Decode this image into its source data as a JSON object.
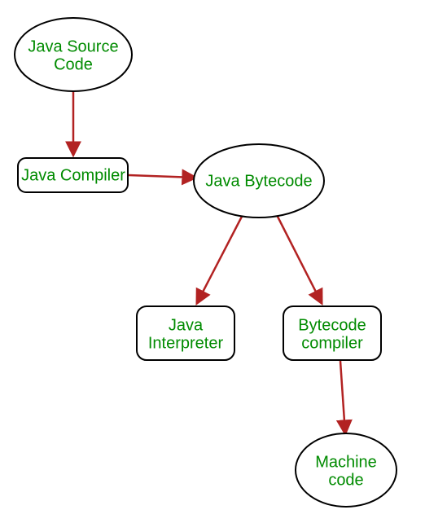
{
  "diagram": {
    "nodes": {
      "source": {
        "label_line1": "Java Source",
        "label_line2": "Code",
        "shape": "ellipse"
      },
      "compiler": {
        "label_line1": "Java Compiler",
        "label_line2": "",
        "shape": "roundrect"
      },
      "bytecode": {
        "label_line1": "Java Bytecode",
        "label_line2": "",
        "shape": "ellipse"
      },
      "interpreter": {
        "label_line1": "Java",
        "label_line2": "Interpreter",
        "shape": "roundrect"
      },
      "bcompiler": {
        "label_line1": "Bytecode",
        "label_line2": "compiler",
        "shape": "roundrect"
      },
      "machine": {
        "label_line1": "Machine",
        "label_line2": "code",
        "shape": "ellipse"
      }
    },
    "edges": [
      {
        "from": "source",
        "to": "compiler"
      },
      {
        "from": "compiler",
        "to": "bytecode"
      },
      {
        "from": "bytecode",
        "to": "interpreter"
      },
      {
        "from": "bytecode",
        "to": "bcompiler"
      },
      {
        "from": "bcompiler",
        "to": "machine"
      }
    ]
  }
}
